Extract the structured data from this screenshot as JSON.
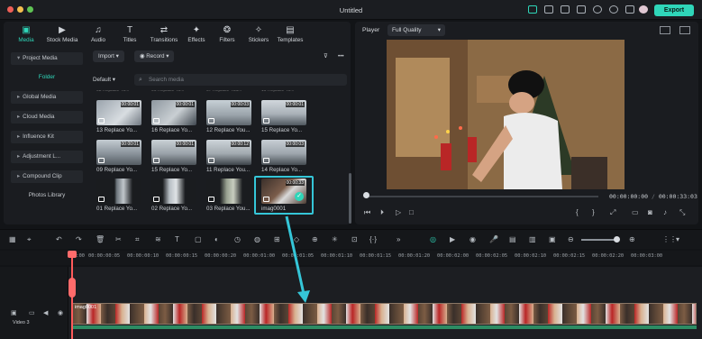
{
  "window": {
    "title": "Untitled",
    "export_label": "Export",
    "accent": "#2fd6b9"
  },
  "tabs": [
    {
      "label": "Media",
      "icon": "media-icon",
      "active": true
    },
    {
      "label": "Stock Media",
      "icon": "stock-media-icon"
    },
    {
      "label": "Audio",
      "icon": "music-note-icon"
    },
    {
      "label": "Titles",
      "icon": "text-t-icon"
    },
    {
      "label": "Transitions",
      "icon": "transitions-icon"
    },
    {
      "label": "Effects",
      "icon": "effects-icon"
    },
    {
      "label": "Filters",
      "icon": "filters-icon"
    },
    {
      "label": "Stickers",
      "icon": "stickers-icon"
    },
    {
      "label": "Templates",
      "icon": "templates-icon"
    }
  ],
  "sidebar": {
    "project_media": "Project Media",
    "folder": "Folder",
    "items": [
      "Global Media",
      "Cloud Media",
      "Influence Kit",
      "Adjustment L...",
      "Compound Clip"
    ],
    "photos_library": "Photos Library"
  },
  "media_toolbar": {
    "import_label": "Import",
    "record_label": "Record",
    "sort_label": "Default",
    "search_placeholder": "Search media"
  },
  "media_items": [
    {
      "label": "13 Replace Yo...",
      "duration": "00:00:01"
    },
    {
      "label": "16 Replace Yo...",
      "duration": "00:00:01"
    },
    {
      "label": "12 Replace You...",
      "duration": "00:00:03"
    },
    {
      "label": "15 Replace Yo...",
      "duration": "00:00:01"
    },
    {
      "label": "09 Replace Yo...",
      "duration": "00:00:01"
    },
    {
      "label": "15 Replace Yo...",
      "duration": "00:00:01"
    },
    {
      "label": "11 Replace You...",
      "duration": "00:00:12"
    },
    {
      "label": "14 Replace Yo...",
      "duration": "00:00:03"
    },
    {
      "label": "01 Replace Yo...",
      "duration": ""
    },
    {
      "label": "02 Replace Yo...",
      "duration": ""
    },
    {
      "label": "03 Replace You...",
      "duration": ""
    },
    {
      "label": "imag0001",
      "duration": "00:00:33"
    }
  ],
  "player": {
    "label": "Player",
    "quality": "Full Quality",
    "current_time": "00:00:00:00",
    "total_time": "00:00:33:03"
  },
  "ruler": [
    "00:00",
    "00:00:00:05",
    "00:00:00:10",
    "00:00:00:15",
    "00:00:00:20",
    "00:00:01:00",
    "00:00:01:05",
    "00:00:01:10",
    "00:00:01:15",
    "00:00:01:20",
    "00:00:02:00",
    "00:00:02:05",
    "00:00:02:10",
    "00:00:02:15",
    "00:00:02:20",
    "00:00:03:00"
  ],
  "timeline": {
    "clip_name": "imag0001",
    "track_label": "Video 3"
  }
}
